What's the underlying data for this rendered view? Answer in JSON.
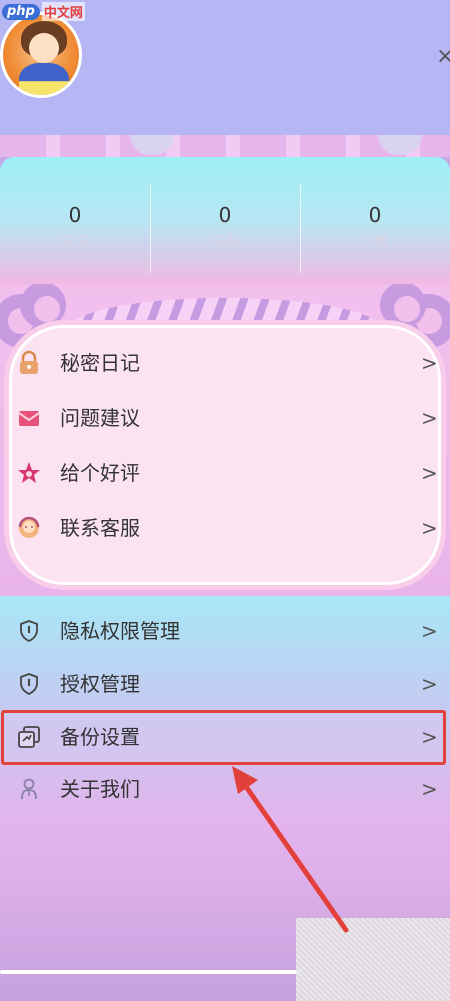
{
  "watermark": {
    "brand": "php",
    "site": "中文网"
  },
  "header": {
    "close_glyph": "×"
  },
  "stats": [
    {
      "value": "0",
      "label": "日记"
    },
    {
      "value": "0",
      "label": "天数"
    },
    {
      "value": "0",
      "label": "字数"
    }
  ],
  "card_menu": [
    {
      "label": "秘密日记",
      "icon": "lock-icon"
    },
    {
      "label": "问题建议",
      "icon": "mail-icon"
    },
    {
      "label": "给个好评",
      "icon": "star-icon"
    },
    {
      "label": "联系客服",
      "icon": "support-icon"
    }
  ],
  "settings_menu": [
    {
      "label": "隐私权限管理",
      "icon": "shield-icon"
    },
    {
      "label": "授权管理",
      "icon": "shield-icon"
    },
    {
      "label": "备份设置",
      "icon": "backup-icon"
    },
    {
      "label": "关于我们",
      "icon": "info-person-icon"
    }
  ],
  "chevron": ">",
  "colors": {
    "highlight": "#e2403b",
    "arrow": "#e2403b"
  }
}
